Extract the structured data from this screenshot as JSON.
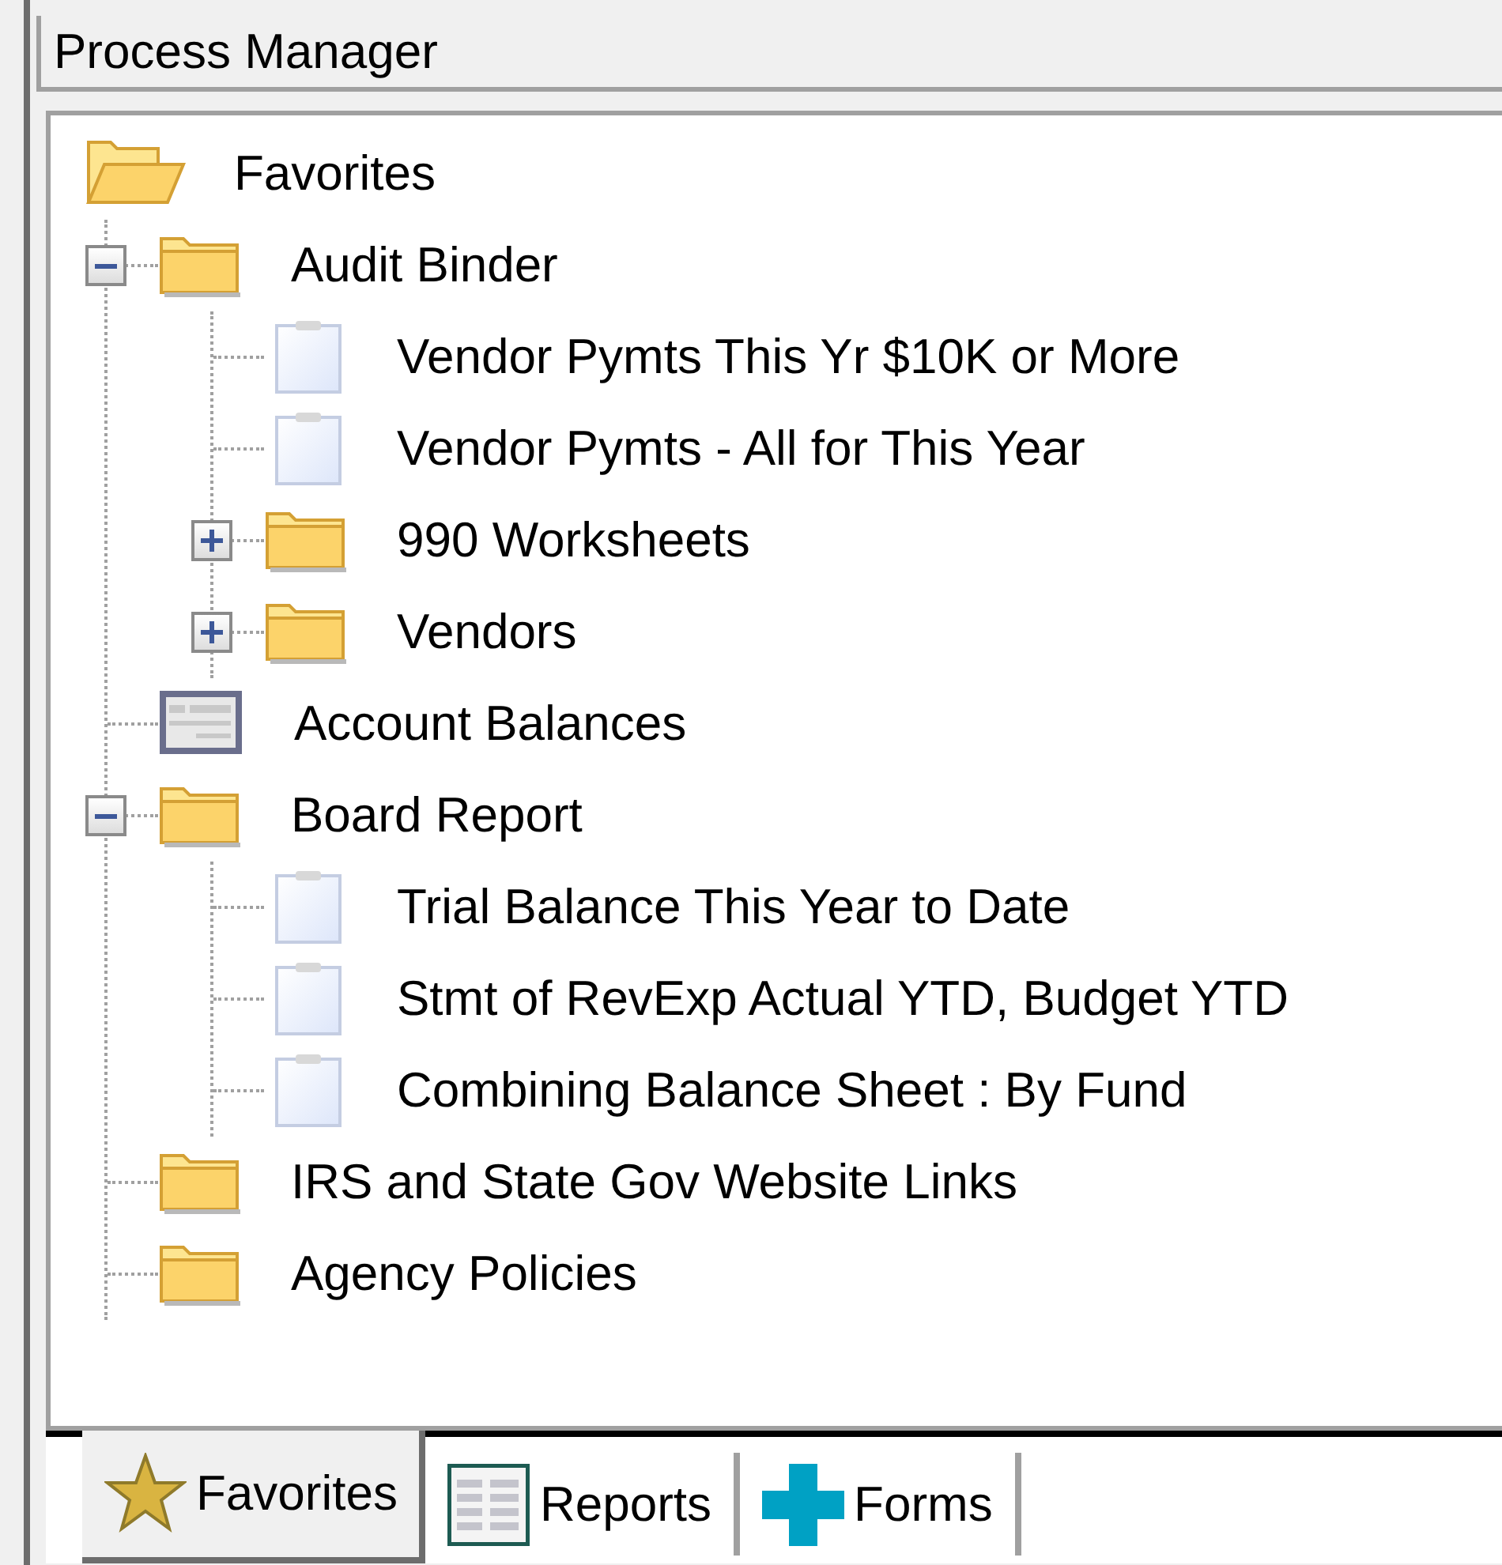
{
  "panel": {
    "title": "Process Manager"
  },
  "tree": [
    {
      "label": "Favorites",
      "kind": "folder",
      "children": [
        {
          "label": "Audit Binder",
          "kind": "folder",
          "expanded": true,
          "children": [
            {
              "label": "Vendor Pymts This Yr $10K or More",
              "kind": "report"
            },
            {
              "label": "Vendor Pymts - All for This Year",
              "kind": "report"
            },
            {
              "label": "990 Worksheets",
              "kind": "folder",
              "expanded": false
            },
            {
              "label": "Vendors",
              "kind": "folder",
              "expanded": false
            }
          ]
        },
        {
          "label": "Account Balances",
          "kind": "form"
        },
        {
          "label": "Board Report",
          "kind": "folder",
          "expanded": true,
          "children": [
            {
              "label": "Trial Balance This Year to Date",
              "kind": "report"
            },
            {
              "label": "Stmt of RevExp Actual YTD, Budget YTD",
              "kind": "report"
            },
            {
              "label": "Combining Balance Sheet : By Fund",
              "kind": "report"
            }
          ]
        },
        {
          "label": "IRS and State Gov Website Links",
          "kind": "folder"
        },
        {
          "label": "Agency Policies",
          "kind": "folder"
        }
      ]
    }
  ],
  "tabs": [
    {
      "label": "Favorites",
      "selected": true
    },
    {
      "label": "Reports",
      "selected": false
    },
    {
      "label": "Forms",
      "selected": false
    }
  ]
}
